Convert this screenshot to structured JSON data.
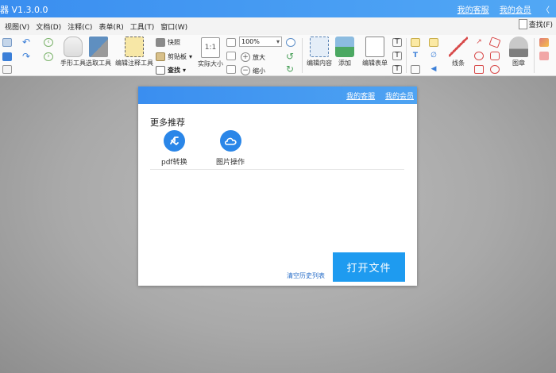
{
  "app": {
    "title": "器 V1.3.0.0",
    "customer_service": "我的客服",
    "membership": "我的会员",
    "collapse": "〈"
  },
  "menu": {
    "items": [
      "视图(V)",
      "文档(D)",
      "注释(C)",
      "表单(R)",
      "工具(T)",
      "窗口(W)"
    ],
    "search_label": "查找(F)"
  },
  "toolbar": {
    "hand_tool": "手形工具",
    "select_tool": "选取工具",
    "edit_annotation_tool": "编辑注释工具",
    "snapshot": "快照",
    "clipboard": "剪贴板",
    "find": "查找",
    "actual_size": "实际大小",
    "zoom_value": "100%",
    "zoom_in": "放大",
    "zoom_out": "缩小",
    "edit_content": "编辑内容",
    "add": "添加",
    "edit_form": "编辑表单",
    "line": "线条",
    "stamp": "图章"
  },
  "dialog": {
    "customer_service": "我的客服",
    "membership": "我的会员",
    "section_title": "更多推荐",
    "recommendations": [
      {
        "label": "pdf转换",
        "icon": "pdf-convert-icon"
      },
      {
        "label": "图片操作",
        "icon": "cloud-image-icon"
      }
    ],
    "clear_history": "清空历史列表",
    "open_file": "打开文件"
  },
  "colors": {
    "accent": "#3a8ef0",
    "primary_button": "#1e9bf0",
    "icon_blue": "#2a86e8"
  }
}
